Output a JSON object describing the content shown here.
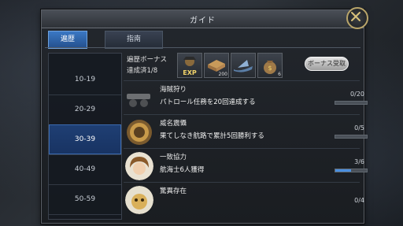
{
  "window": {
    "title": "ガイド"
  },
  "tabs": [
    {
      "label": "遍歴",
      "active": true
    },
    {
      "label": "指南",
      "active": false
    }
  ],
  "sidebar": {
    "items": [
      {
        "label": "10-19"
      },
      {
        "label": "20-29"
      },
      {
        "label": "30-39",
        "selected": true
      },
      {
        "label": "40-49"
      },
      {
        "label": "50-59"
      }
    ]
  },
  "bonus": {
    "label": "遍歴ボーナス",
    "progress": "達成済1/8",
    "rewards": [
      {
        "icon": "exp-captain-icon",
        "count": ""
      },
      {
        "icon": "lumber-plank-icon",
        "count": "200"
      },
      {
        "icon": "ship-icon",
        "count": ""
      },
      {
        "icon": "money-bag-icon",
        "count": "6"
      }
    ],
    "button": "ボーナス受取"
  },
  "quests": [
    {
      "title": "海賊狩り",
      "desc": "パトロール任務を20回達成する",
      "count": "0/20",
      "progress": 0.0,
      "icon": "cannon-icon"
    },
    {
      "title": "威名震懾",
      "desc": "果てしなき航路で累計5回勝利する",
      "count": "0/5",
      "progress": 0.0,
      "icon": "medal-icon"
    },
    {
      "title": "一致協力",
      "desc": "航海士6人獲得",
      "count": "3/6",
      "progress": 0.5,
      "icon": "navigator-portrait-icon"
    },
    {
      "title": "驚異存在",
      "desc": "",
      "count": "0/4",
      "progress": 0.0,
      "icon": "creature-portrait-icon"
    }
  ],
  "colors": {
    "accent": "#3b78c4",
    "progress_fill": "#4a8fe0",
    "frame_gold": "#b9a56a"
  }
}
